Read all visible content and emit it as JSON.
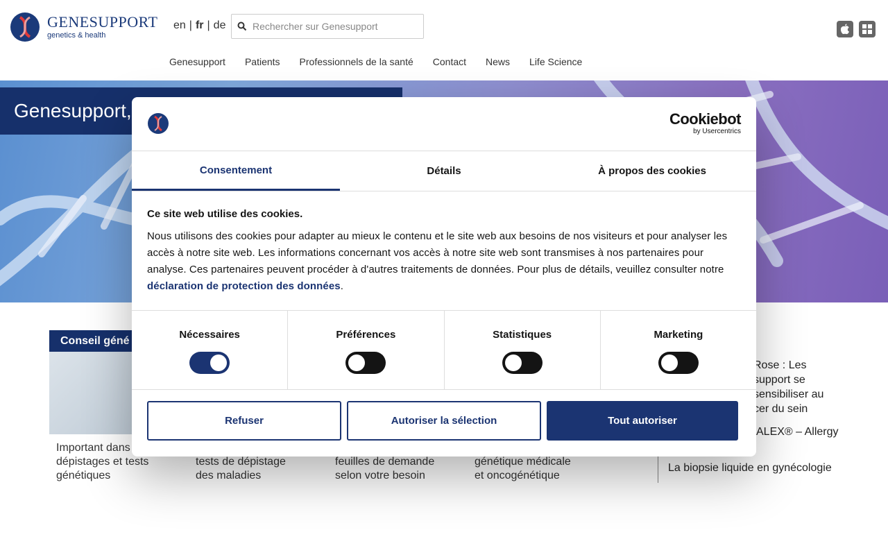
{
  "header": {
    "logo_name": "GENESUPPORT",
    "logo_sub": "genetics & health",
    "languages": [
      "en",
      "fr",
      "de"
    ],
    "lang_sep": "|",
    "active_language": "fr",
    "search_placeholder": "Rechercher sur Genesupport",
    "nav": [
      "Genesupport",
      "Patients",
      "Professionnels de la santé",
      "Contact",
      "News",
      "Life Science"
    ]
  },
  "hero": {
    "title": "Genesupport,"
  },
  "cards": {
    "label_1": "Conseil géné",
    "desc_1": [
      "Important dans",
      "dépistages et tests",
      "génétiques"
    ],
    "desc_2": [
      "tests de dépistage",
      "des maladies"
    ],
    "desc_3": [
      "feuilles de demande",
      "selon votre besoin"
    ],
    "desc_4": [
      "génétique médicale",
      "et oncogénétique"
    ]
  },
  "news": {
    "item_1": [
      "Rose : Les",
      "support se",
      "sensibiliser au",
      "cer du sein"
    ],
    "item_2": "ALEX® – Allergy",
    "item_3": "La biopsie liquide en gynécologie"
  },
  "cookie_dialog": {
    "brand": "Cookiebot",
    "brand_sub": "by Usercentrics",
    "tabs": [
      "Consentement",
      "Détails",
      "À propos des cookies"
    ],
    "active_tab": "Consentement",
    "title": "Ce site web utilise des cookies.",
    "text": "Nous utilisons des cookies pour adapter au mieux le contenu et le site web aux besoins de nos visiteurs et pour analyser les accès à notre site web. Les informations concernant vos accès à notre site web sont transmises à nos partenaires pour analyse. Ces partenaires peuvent procéder à d'autres traitements de données. Pour plus de détails, veuillez consulter notre ",
    "link": "déclaration de protection des données",
    "text_end": ".",
    "toggles": [
      {
        "label": "Nécessaires",
        "on": true
      },
      {
        "label": "Préférences",
        "on": false
      },
      {
        "label": "Statistiques",
        "on": false
      },
      {
        "label": "Marketing",
        "on": false
      }
    ],
    "buttons": {
      "refuse": "Refuser",
      "allow_selection": "Autoriser la sélection",
      "allow_all": "Tout autoriser"
    }
  },
  "colors": {
    "brand": "#1b3472",
    "toggle_off": "#141414"
  }
}
